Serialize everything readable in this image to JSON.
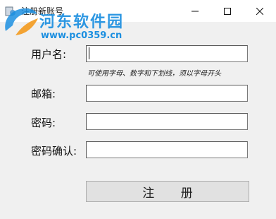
{
  "window": {
    "title": "注册新账号",
    "minimize_icon": "minimize-icon",
    "maximize_icon": "maximize-icon",
    "close_icon": "close-icon"
  },
  "watermark": {
    "name": "河东软件园",
    "url": "www.pc0359.cn"
  },
  "form": {
    "username_label": "用户名:",
    "username_value": "",
    "username_hint": "可使用字母、数字和下划线，须以字母开头",
    "email_label": "邮箱:",
    "email_value": "",
    "password_label": "密码:",
    "password_value": "",
    "confirm_label": "密码确认:",
    "confirm_value": ""
  },
  "actions": {
    "register_label": "注 册"
  }
}
